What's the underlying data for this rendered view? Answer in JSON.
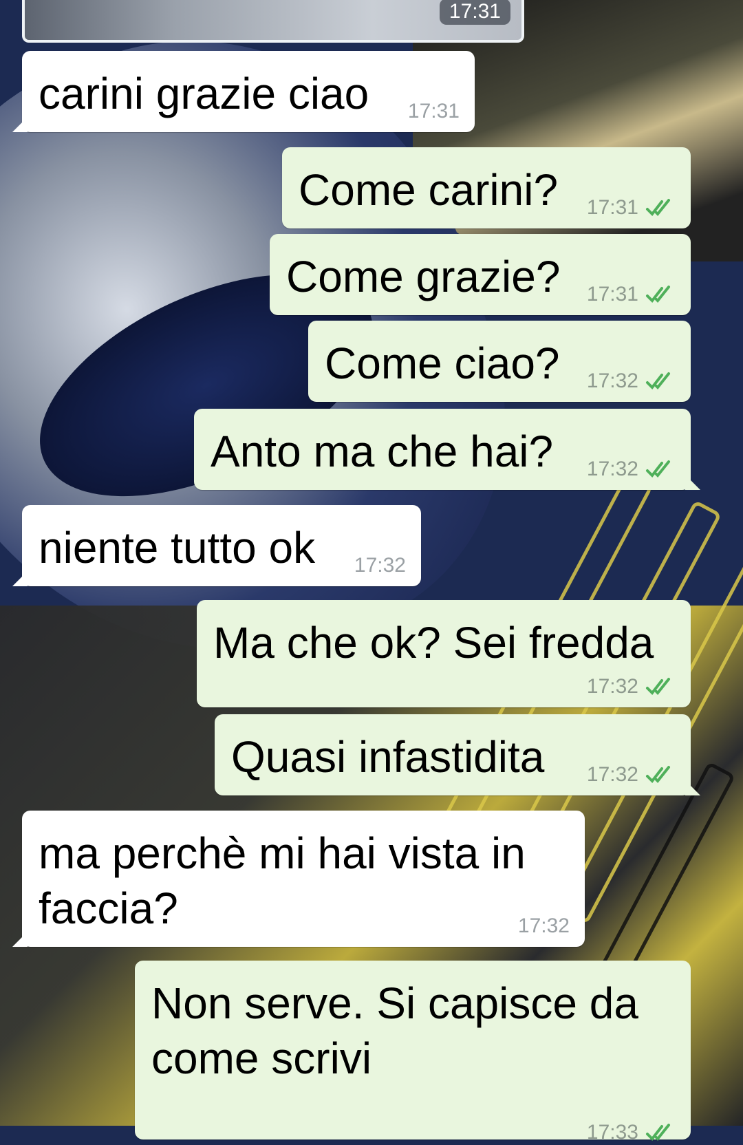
{
  "top_preview": {
    "time": "17:31"
  },
  "messages": [
    {
      "direction": "in",
      "text": "carini grazie ciao",
      "time": "17:31"
    },
    {
      "direction": "out",
      "text": "Come carini?",
      "time": "17:31",
      "status": "read"
    },
    {
      "direction": "out",
      "text": "Come grazie?",
      "time": "17:31",
      "status": "read"
    },
    {
      "direction": "out",
      "text": "Come ciao?",
      "time": "17:32",
      "status": "read"
    },
    {
      "direction": "out",
      "text": "Anto ma che hai?",
      "time": "17:32",
      "status": "read"
    },
    {
      "direction": "in",
      "text": "niente tutto ok",
      "time": "17:32"
    },
    {
      "direction": "out",
      "text": "Ma che ok? Sei fredda",
      "time": "17:32",
      "status": "read"
    },
    {
      "direction": "out",
      "text": "Quasi infastidita",
      "time": "17:32",
      "status": "read"
    },
    {
      "direction": "in",
      "text": "ma perchè mi hai vista in faccia?",
      "time": "17:32"
    },
    {
      "direction": "out",
      "text": "Non serve. Si capisce da come scrivi",
      "time": "17:33",
      "status": "read"
    }
  ],
  "colors": {
    "incoming": "#ffffff",
    "outgoing": "#e9f6de",
    "read_tick": "#4fb05a"
  },
  "icons": {
    "read_status": "double-check-icon"
  }
}
